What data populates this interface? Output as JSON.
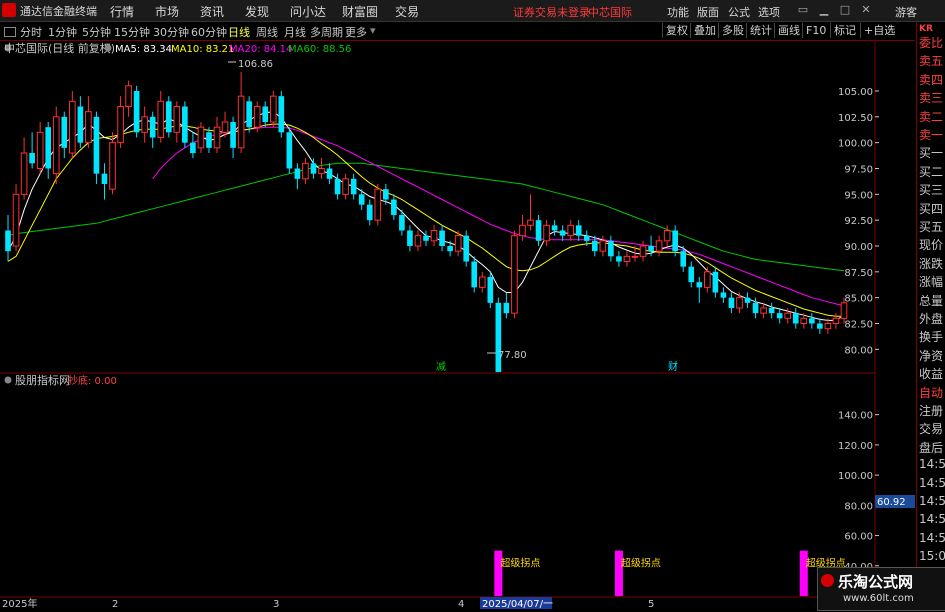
{
  "menubar": {
    "app_title": "通达信金融终端",
    "menus": [
      "行情",
      "市场",
      "资讯",
      "发现",
      "问小达",
      "财富圈",
      "交易"
    ],
    "alert": "证券交易未登录",
    "stock_name": "中芯国际",
    "right_menus": [
      "功能",
      "版面",
      "公式",
      "选项"
    ],
    "guest": "游客"
  },
  "toolbar": {
    "periods": [
      "分时",
      "1分钟",
      "5分钟",
      "15分钟",
      "30分钟",
      "60分钟",
      "日线",
      "周线",
      "月线",
      "多周期",
      "更多"
    ],
    "active_period": "日线",
    "buttons": [
      "复权",
      "叠加",
      "多股",
      "统计",
      "画线",
      "F10",
      "标记",
      "+自选"
    ]
  },
  "main_legend": {
    "title": "中芯国际(日线 前复权)",
    "ma5": "MA5: 83.34",
    "ma10": "MA10: 83.21",
    "ma20": "MA20: 84.14",
    "ma60": "MA60: 88.56"
  },
  "annotations": {
    "high": "106.86",
    "low": "77.80",
    "tag_jian": "减",
    "tag_cai": "财"
  },
  "sub_legend": {
    "title": "股朋指标网",
    "label": "抄底: 0.00",
    "signal_text": "超级拐点",
    "value_tag": "60.92"
  },
  "colors": {
    "up": "#ff3030",
    "down": "#00e5ff",
    "ma5": "#ffffff",
    "ma10": "#ffff00",
    "ma20": "#ff00ff",
    "ma60": "#00c800",
    "grid": "#7a0000",
    "signal": "#ff00ff"
  },
  "x_axis": {
    "labels": [
      "2025年",
      "2",
      "3",
      "4",
      "2025/04/07/一",
      "5",
      "6"
    ]
  },
  "right_panel": {
    "kr": "KR",
    "items": [
      "委比",
      "卖五",
      "卖四",
      "卖三",
      "卖二",
      "卖一",
      "买一",
      "买二",
      "买三",
      "买四",
      "买五",
      "现价",
      "涨跌",
      "涨幅",
      "总量",
      "外盘",
      "换手",
      "净资",
      "收益",
      "自动",
      "注册",
      "交易",
      "盘后",
      "14:56",
      "14:56",
      "14:56",
      "14:57",
      "14:57",
      "15:00",
      "15:01"
    ]
  },
  "watermark": {
    "title": "乐淘公式网",
    "url": "www.60lt.com"
  },
  "chart_data": [
    {
      "type": "candlestick",
      "title": "中芯国际(日线 前复权)",
      "yticks": [
        80.0,
        82.5,
        85.0,
        87.5,
        90.0,
        92.5,
        95.0,
        97.5,
        100.0,
        102.5,
        105.0
      ],
      "ylim": [
        78.0,
        108.0
      ],
      "grid": false,
      "candles": [
        [
          91.5,
          89.5,
          93.0,
          88.5
        ],
        [
          90.0,
          95.0,
          96.0,
          89.5
        ],
        [
          95.0,
          99.0,
          100.5,
          94.5
        ],
        [
          99.0,
          98.0,
          101.0,
          97.5
        ],
        [
          97.5,
          101.0,
          102.0,
          97.0
        ],
        [
          101.5,
          97.5,
          102.0,
          96.5
        ],
        [
          97.0,
          102.5,
          103.5,
          96.0
        ],
        [
          102.5,
          99.5,
          103.0,
          98.5
        ],
        [
          99.0,
          104.0,
          105.0,
          98.5
        ],
        [
          103.5,
          100.0,
          104.5,
          99.5
        ],
        [
          100.0,
          103.0,
          104.5,
          99.5
        ],
        [
          102.5,
          97.0,
          103.0,
          96.0
        ],
        [
          97.0,
          96.0,
          98.0,
          94.5
        ],
        [
          95.5,
          100.0,
          101.0,
          95.0
        ],
        [
          100.0,
          103.5,
          104.5,
          99.5
        ],
        [
          103.5,
          105.5,
          106.0,
          102.5
        ],
        [
          105.0,
          101.0,
          105.5,
          100.5
        ],
        [
          101.0,
          102.5,
          103.5,
          100.0
        ],
        [
          102.5,
          100.5,
          103.0,
          99.5
        ],
        [
          100.5,
          104.0,
          105.0,
          100.0
        ],
        [
          104.0,
          101.0,
          104.5,
          100.5
        ],
        [
          101.0,
          103.5,
          104.0,
          100.0
        ],
        [
          103.5,
          100.0,
          104.0,
          99.5
        ],
        [
          100.0,
          99.0,
          101.0,
          98.5
        ],
        [
          99.5,
          101.5,
          102.0,
          99.0
        ],
        [
          101.0,
          99.5,
          101.5,
          99.0
        ],
        [
          99.5,
          101.5,
          102.5,
          99.0
        ],
        [
          101.0,
          102.0,
          103.0,
          100.5
        ],
        [
          102.0,
          99.5,
          102.5,
          98.5
        ],
        [
          99.5,
          104.5,
          106.86,
          99.0
        ],
        [
          104.0,
          101.5,
          104.5,
          101.0
        ],
        [
          101.5,
          103.5,
          104.0,
          101.0
        ],
        [
          103.5,
          102.0,
          104.0,
          101.5
        ],
        [
          102.0,
          104.5,
          105.0,
          101.5
        ],
        [
          104.5,
          101.0,
          105.0,
          100.5
        ],
        [
          101.0,
          97.5,
          101.5,
          97.0
        ],
        [
          97.5,
          96.5,
          98.0,
          95.5
        ],
        [
          96.5,
          98.0,
          98.5,
          96.0
        ],
        [
          98.0,
          97.0,
          98.5,
          96.5
        ],
        [
          97.0,
          97.5,
          98.5,
          96.5
        ],
        [
          97.5,
          96.5,
          98.0,
          96.0
        ],
        [
          96.5,
          95.0,
          97.0,
          94.5
        ],
        [
          95.0,
          96.5,
          97.0,
          94.5
        ],
        [
          96.5,
          95.0,
          97.0,
          94.5
        ],
        [
          95.0,
          94.0,
          95.5,
          93.5
        ],
        [
          94.0,
          92.5,
          94.5,
          92.0
        ],
        [
          92.5,
          95.5,
          96.0,
          92.0
        ],
        [
          95.5,
          94.5,
          96.0,
          94.0
        ],
        [
          94.5,
          93.0,
          95.0,
          92.5
        ],
        [
          93.0,
          91.5,
          93.5,
          91.0
        ],
        [
          91.5,
          90.0,
          92.0,
          89.5
        ],
        [
          90.0,
          91.0,
          91.5,
          89.5
        ],
        [
          91.0,
          90.5,
          91.5,
          90.0
        ],
        [
          90.5,
          91.5,
          92.0,
          90.0
        ],
        [
          91.5,
          90.0,
          92.0,
          89.5
        ],
        [
          90.0,
          89.5,
          90.5,
          89.0
        ],
        [
          89.5,
          91.0,
          91.5,
          89.0
        ],
        [
          91.0,
          88.5,
          91.5,
          88.0
        ],
        [
          88.5,
          86.0,
          89.0,
          85.5
        ],
        [
          86.0,
          87.0,
          87.5,
          85.5
        ],
        [
          87.0,
          84.5,
          87.5,
          84.0
        ],
        [
          84.5,
          77.8,
          85.0,
          77.8
        ],
        [
          84.5,
          83.5,
          85.5,
          83.0
        ],
        [
          83.5,
          91.0,
          91.5,
          83.0
        ],
        [
          91.0,
          92.0,
          93.0,
          90.5
        ],
        [
          92.0,
          92.5,
          95.0,
          91.5
        ],
        [
          92.5,
          90.5,
          93.0,
          90.0
        ],
        [
          90.5,
          92.0,
          92.5,
          90.0
        ],
        [
          92.0,
          91.5,
          92.5,
          91.0
        ],
        [
          91.5,
          91.0,
          92.0,
          90.5
        ],
        [
          91.0,
          92.0,
          92.5,
          90.5
        ],
        [
          92.0,
          91.0,
          92.5,
          90.5
        ],
        [
          91.0,
          90.5,
          91.5,
          90.0
        ],
        [
          90.5,
          89.5,
          91.0,
          89.0
        ],
        [
          89.5,
          90.5,
          91.0,
          89.0
        ],
        [
          90.5,
          89.0,
          91.0,
          88.5
        ],
        [
          89.0,
          88.5,
          89.5,
          88.0
        ],
        [
          88.5,
          89.0,
          89.5,
          88.0
        ],
        [
          89.0,
          89.0,
          90.0,
          88.5
        ],
        [
          89.0,
          90.0,
          90.5,
          88.5
        ],
        [
          90.0,
          89.5,
          91.0,
          89.0
        ],
        [
          89.5,
          90.5,
          91.0,
          89.0
        ],
        [
          90.5,
          91.5,
          92.0,
          90.0
        ],
        [
          91.5,
          89.5,
          92.0,
          89.0
        ],
        [
          89.5,
          88.0,
          90.0,
          87.5
        ],
        [
          88.0,
          86.5,
          88.5,
          86.0
        ],
        [
          86.5,
          86.0,
          87.0,
          84.5
        ],
        [
          86.0,
          87.5,
          88.0,
          85.5
        ],
        [
          87.5,
          85.5,
          88.0,
          85.0
        ],
        [
          85.5,
          85.0,
          86.0,
          84.5
        ],
        [
          85.0,
          84.0,
          85.5,
          83.5
        ],
        [
          84.0,
          85.0,
          85.5,
          83.5
        ],
        [
          85.0,
          84.5,
          85.5,
          84.0
        ],
        [
          84.5,
          83.5,
          85.0,
          83.0
        ],
        [
          83.5,
          84.0,
          84.5,
          83.0
        ],
        [
          84.0,
          83.5,
          84.5,
          83.0
        ],
        [
          83.5,
          83.0,
          84.0,
          82.5
        ],
        [
          83.0,
          83.5,
          84.0,
          82.5
        ],
        [
          83.5,
          82.5,
          84.0,
          82.0
        ],
        [
          82.5,
          83.0,
          83.5,
          82.0
        ],
        [
          83.0,
          82.5,
          83.5,
          82.0
        ],
        [
          82.5,
          82.0,
          83.0,
          81.5
        ],
        [
          82.0,
          82.5,
          83.0,
          81.5
        ],
        [
          82.5,
          83.0,
          83.5,
          82.0
        ],
        [
          83.0,
          84.5,
          85.0,
          82.5
        ]
      ],
      "ma5": [
        89.5,
        91.0,
        93.5,
        95.5,
        97.0,
        98.5,
        99.5,
        100.0,
        100.5,
        101.0,
        101.8,
        101.2,
        100.5,
        100.3,
        100.8,
        101.5,
        102.0,
        102.2,
        102.0,
        101.8,
        102.3,
        102.0,
        101.5,
        101.0,
        100.6,
        100.2,
        100.4,
        100.8,
        101.0,
        101.8,
        102.2,
        102.6,
        102.9,
        103.0,
        102.4,
        101.3,
        100.2,
        99.2,
        98.0,
        97.3,
        97.0,
        96.5,
        96.0,
        95.8,
        95.3,
        94.8,
        94.5,
        94.3,
        94.0,
        93.3,
        92.5,
        91.7,
        91.0,
        90.8,
        90.5,
        90.3,
        90.0,
        89.5,
        88.8,
        88.2,
        87.5,
        86.0,
        85.5,
        85.5,
        86.5,
        88.0,
        89.5,
        91.0,
        91.4,
        91.3,
        91.2,
        91.1,
        91.0,
        90.8,
        90.6,
        90.3,
        89.9,
        89.6,
        89.3,
        89.2,
        89.3,
        89.6,
        89.9,
        90.1,
        89.8,
        89.2,
        88.4,
        87.6,
        87.0,
        86.3,
        85.6,
        85.2,
        84.9,
        84.6,
        84.4,
        84.1,
        83.9,
        83.7,
        83.5,
        83.3,
        83.1,
        82.9,
        82.8,
        82.8,
        83.3
      ],
      "ma10": [
        88.5,
        89.0,
        90.5,
        92.0,
        93.5,
        95.0,
        96.5,
        97.5,
        98.5,
        99.3,
        100.0,
        100.4,
        100.5,
        100.6,
        100.8,
        101.0,
        101.2,
        101.3,
        101.3,
        101.3,
        101.5,
        101.6,
        101.6,
        101.5,
        101.3,
        101.2,
        101.1,
        101.0,
        101.0,
        101.2,
        101.3,
        101.5,
        101.7,
        101.8,
        101.8,
        101.7,
        101.4,
        101.0,
        100.5,
        99.9,
        99.4,
        98.8,
        98.1,
        97.4,
        96.7,
        96.1,
        95.6,
        95.2,
        94.9,
        94.5,
        94.0,
        93.5,
        93.0,
        92.5,
        92.0,
        91.6,
        91.2,
        90.8,
        90.3,
        89.8,
        89.2,
        88.6,
        88.0,
        87.7,
        87.6,
        87.7,
        88.0,
        88.5,
        89.0,
        89.5,
        89.9,
        90.1,
        90.2,
        90.3,
        90.3,
        90.2,
        90.1,
        90.0,
        89.8,
        89.6,
        89.5,
        89.4,
        89.4,
        89.4,
        89.3,
        89.1,
        88.8,
        88.4,
        87.9,
        87.4,
        86.9,
        86.5,
        86.1,
        85.7,
        85.4,
        85.1,
        84.8,
        84.5,
        84.2,
        83.9,
        83.7,
        83.5,
        83.3,
        83.2,
        83.2
      ],
      "ma20": [
        null,
        null,
        null,
        null,
        null,
        null,
        null,
        null,
        null,
        null,
        null,
        null,
        null,
        null,
        null,
        null,
        null,
        null,
        96.5,
        97.5,
        98.3,
        99.0,
        99.5,
        100.0,
        100.3,
        100.6,
        100.8,
        101.0,
        101.1,
        101.2,
        101.3,
        101.4,
        101.5,
        101.5,
        101.5,
        101.4,
        101.2,
        100.9,
        100.6,
        100.3,
        100.0,
        99.7,
        99.3,
        98.9,
        98.5,
        98.1,
        97.7,
        97.3,
        96.9,
        96.5,
        96.1,
        95.7,
        95.3,
        94.9,
        94.5,
        94.1,
        93.7,
        93.3,
        92.9,
        92.5,
        92.1,
        91.8,
        91.5,
        91.2,
        91.0,
        90.8,
        90.7,
        90.6,
        90.6,
        90.6,
        90.6,
        90.6,
        90.6,
        90.6,
        90.6,
        90.5,
        90.4,
        90.3,
        90.2,
        90.1,
        90.0,
        89.9,
        89.8,
        89.7,
        89.6,
        89.4,
        89.2,
        88.9,
        88.6,
        88.3,
        88.0,
        87.7,
        87.4,
        87.1,
        86.8,
        86.5,
        86.2,
        85.9,
        85.6,
        85.3,
        85.0,
        84.8,
        84.6,
        84.4,
        84.2
      ],
      "ma60": [
        91.0,
        91.2,
        91.3,
        91.4,
        91.5,
        91.6,
        91.7,
        91.8,
        91.9,
        92.0,
        92.1,
        92.2,
        92.4,
        92.6,
        92.8,
        93.0,
        93.2,
        93.4,
        93.6,
        93.8,
        94.0,
        94.2,
        94.4,
        94.6,
        94.8,
        95.0,
        95.2,
        95.4,
        95.6,
        95.8,
        96.0,
        96.2,
        96.4,
        96.6,
        96.8,
        97.0,
        97.2,
        97.4,
        97.6,
        97.8,
        97.9,
        98.0,
        98.0,
        98.0,
        98.0,
        97.9,
        97.8,
        97.7,
        97.6,
        97.5,
        97.4,
        97.3,
        97.2,
        97.1,
        97.0,
        96.9,
        96.8,
        96.7,
        96.6,
        96.5,
        96.4,
        96.3,
        96.2,
        96.1,
        96.0,
        95.8,
        95.6,
        95.4,
        95.2,
        95.0,
        94.8,
        94.6,
        94.4,
        94.2,
        94.0,
        93.7,
        93.4,
        93.1,
        92.8,
        92.5,
        92.2,
        91.9,
        91.6,
        91.3,
        91.0,
        90.7,
        90.4,
        90.1,
        89.8,
        89.5,
        89.3,
        89.1,
        88.9,
        88.7,
        88.6,
        88.5,
        88.4,
        88.3,
        88.2,
        88.1,
        88.0,
        87.9,
        87.8,
        87.7,
        87.6
      ]
    },
    {
      "type": "bar",
      "title": "股朋指标网",
      "yticks": [
        40.0,
        60.0,
        80.0,
        100.0,
        120.0,
        140.0
      ],
      "ylim": [
        20.0,
        155.0
      ],
      "signals": [
        {
          "index": 61,
          "value": 50.0
        },
        {
          "index": 76,
          "value": 50.0
        },
        {
          "index": 99,
          "value": 50.0
        }
      ],
      "signal_label": "超级拐点"
    }
  ]
}
